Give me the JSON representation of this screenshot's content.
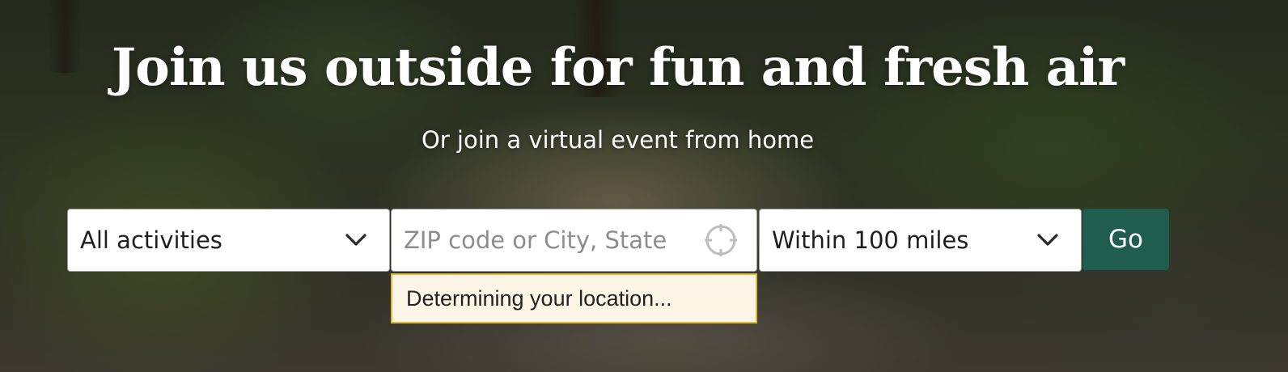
{
  "hero": {
    "headline": "Join us outside for fun and fresh air",
    "subheadline": "Or join a virtual event from home"
  },
  "search": {
    "activity": {
      "selected": "All activities",
      "icon": "chevron-down-icon"
    },
    "location": {
      "value": "",
      "placeholder": "ZIP code or City, State",
      "icon": "locate-crosshair-icon",
      "status": "Determining your location..."
    },
    "distance": {
      "selected": "Within 100 miles",
      "icon": "chevron-down-icon"
    },
    "submit_label": "Go"
  },
  "colors": {
    "go_button": "#1f5e4f",
    "status_background": "#fdf6e6",
    "status_border": "#e3b73c",
    "heading_text": "#ffffff"
  }
}
